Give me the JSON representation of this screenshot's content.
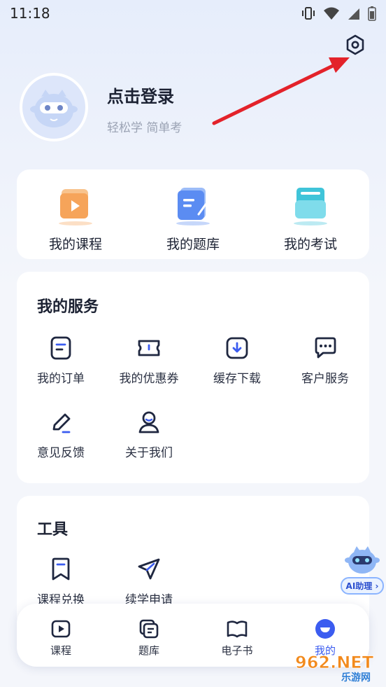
{
  "status": {
    "time": "11:18"
  },
  "profile": {
    "title": "点击登录",
    "subtitle": "轻松学 简单考"
  },
  "quick": [
    {
      "label": "我的课程",
      "icon": "course-folder-icon",
      "color": "#f6a45a"
    },
    {
      "label": "我的题库",
      "icon": "question-bank-icon",
      "color": "#5b8cf2"
    },
    {
      "label": "我的考试",
      "icon": "exam-folder-icon",
      "color": "#3fc4d9"
    }
  ],
  "services": {
    "title": "我的服务",
    "items": [
      {
        "label": "我的订单",
        "icon": "order-icon"
      },
      {
        "label": "我的优惠券",
        "icon": "coupon-icon"
      },
      {
        "label": "缓存下载",
        "icon": "download-icon"
      },
      {
        "label": "客户服务",
        "icon": "chat-icon"
      },
      {
        "label": "意见反馈",
        "icon": "pencil-icon"
      },
      {
        "label": "关于我们",
        "icon": "person-icon"
      }
    ]
  },
  "tools": {
    "title": "工具",
    "items": [
      {
        "label": "课程兑换",
        "icon": "bookmark-icon"
      },
      {
        "label": "续学申请",
        "icon": "send-icon"
      }
    ]
  },
  "tabs": [
    {
      "label": "课程",
      "icon": "video-icon"
    },
    {
      "label": "题库",
      "icon": "stack-icon"
    },
    {
      "label": "电子书",
      "icon": "book-icon"
    },
    {
      "label": "我的",
      "icon": "profile-icon",
      "active": true
    }
  ],
  "ai_assistant": {
    "label": "AI助理 ›"
  },
  "watermark": {
    "text": "962.NET",
    "sub": "乐游网"
  },
  "colors": {
    "accent": "#3b5cf0",
    "arrow": "#e3222a",
    "icon_stroke": "#1f2740"
  }
}
